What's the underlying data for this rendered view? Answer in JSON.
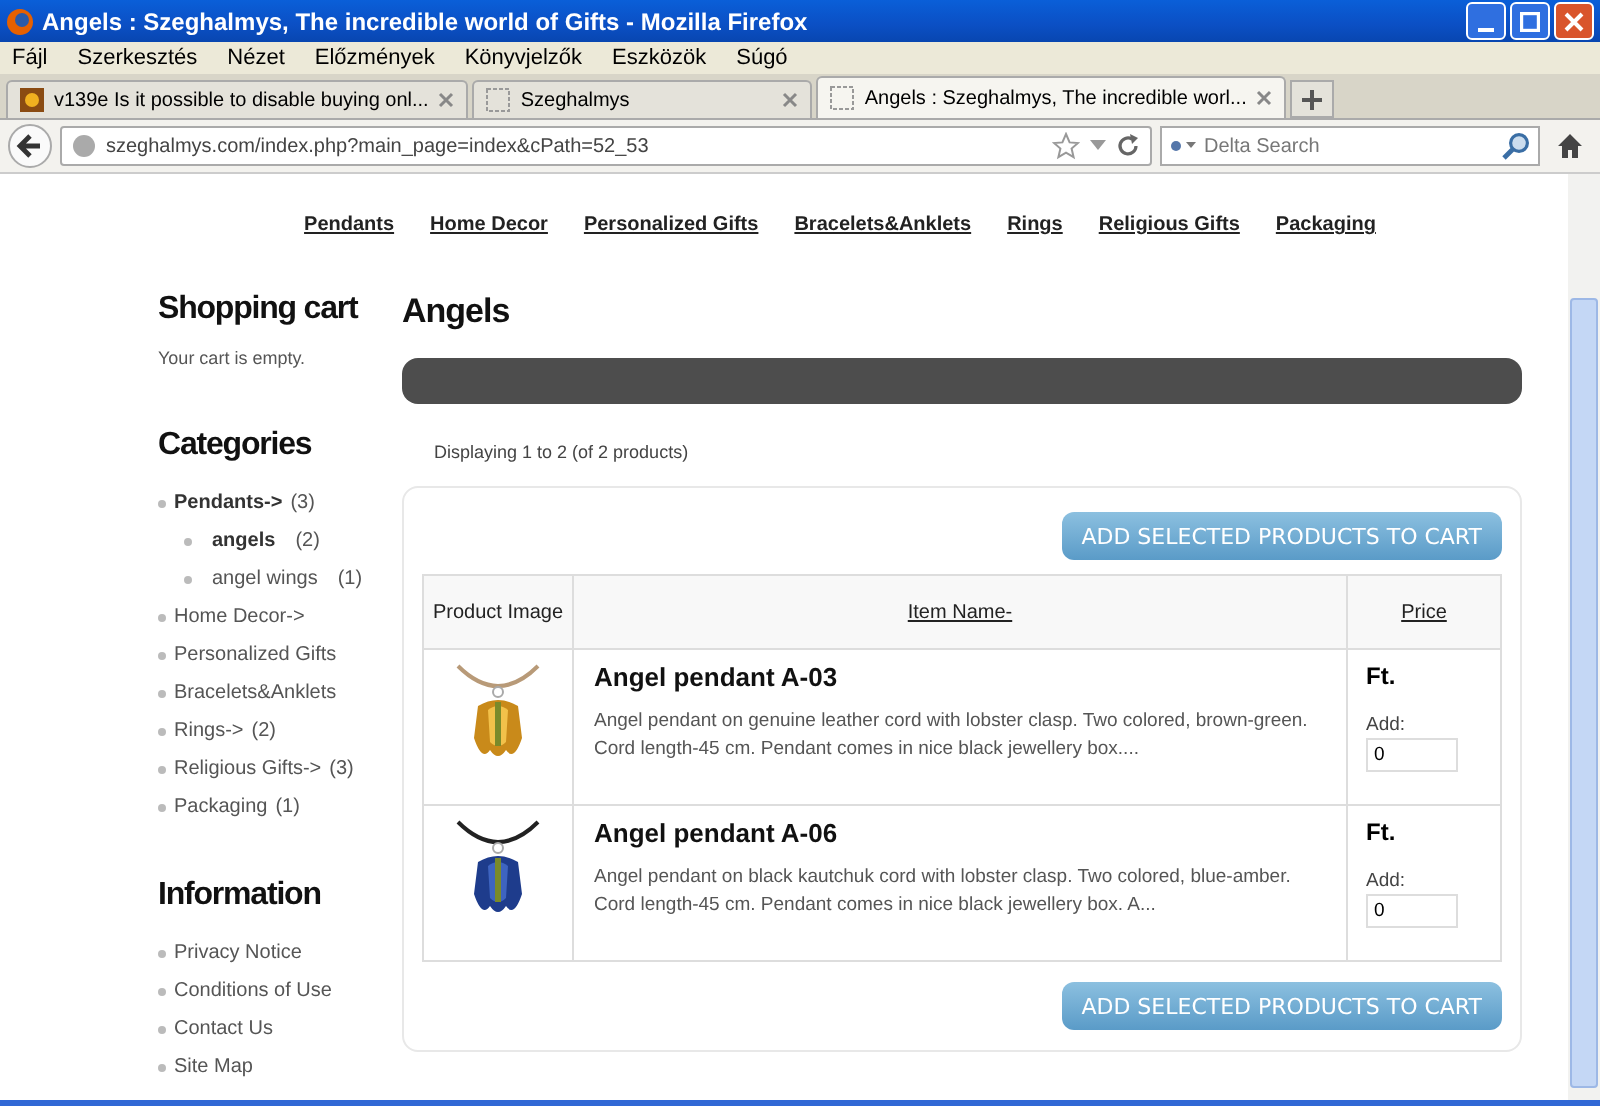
{
  "window": {
    "title": "Angels : Szeghalmys, The incredible world of Gifts - Mozilla Firefox"
  },
  "menu": [
    "Fájl",
    "Szerkesztés",
    "Nézet",
    "Előzmények",
    "Könyvjelzők",
    "Eszközök",
    "Súgó"
  ],
  "tabs": [
    {
      "label": "v139e Is it possible to disable buying onl...",
      "selected": false,
      "kind": "favicon"
    },
    {
      "label": "Szeghalmys",
      "selected": false,
      "kind": "blank"
    },
    {
      "label": "Angels : Szeghalmys, The incredible worl...",
      "selected": true,
      "kind": "blank"
    }
  ],
  "address_bar": {
    "url": "szeghalmys.com/index.php?main_page=index&cPath=52_53"
  },
  "search": {
    "placeholder": "Delta Search"
  },
  "site_nav": [
    "Pendants",
    "Home Decor",
    "Personalized Gifts",
    "Bracelets&Anklets",
    "Rings",
    "Religious Gifts",
    "Packaging"
  ],
  "sidebar": {
    "cart_title": "Shopping cart",
    "cart_text": "Your cart is empty.",
    "categories_title": "Categories",
    "categories": [
      {
        "label": "Pendants->",
        "count": "(3)",
        "selected": true,
        "children": [
          {
            "label": "angels",
            "count": "(2)",
            "selected": true
          },
          {
            "label": "angel wings",
            "count": "(1)",
            "selected": false
          }
        ]
      },
      {
        "label": "Home Decor->",
        "selected": false
      },
      {
        "label": "Personalized Gifts",
        "selected": false
      },
      {
        "label": "Bracelets&Anklets",
        "selected": false
      },
      {
        "label": "Rings->",
        "count": "(2)",
        "selected": false
      },
      {
        "label": "Religious Gifts->",
        "count": "(3)",
        "selected": false
      },
      {
        "label": "Packaging",
        "count": "(1)",
        "selected": false
      }
    ],
    "information_title": "Information",
    "information": [
      "Privacy Notice",
      "Conditions of Use",
      "Contact Us",
      "Site Map"
    ]
  },
  "main": {
    "title": "Angels",
    "listing_count": "Displaying 1 to 2 (of 2 products)",
    "add_button": "ADD SELECTED PRODUCTS TO CART",
    "table": {
      "columns": [
        "Product Image",
        "Item Name-",
        "Price"
      ],
      "rows": [
        {
          "name": "Angel pendant A-03",
          "description": "Angel pendant on genuine leather cord with lobster clasp. Two colored, brown-green. Cord length-45 cm. Pendant comes in nice black jewellery box....",
          "price": "Ft.",
          "add_label": "Add:",
          "quantity": "0",
          "kind": "amber"
        },
        {
          "name": "Angel pendant A-06",
          "description": "Angel pendant on black kautchuk cord with lobster clasp. Two colored, blue-amber. Cord length-45 cm. Pendant comes in nice black jewellery box. A...",
          "price": "Ft.",
          "add_label": "Add:",
          "quantity": "0",
          "kind": "blue"
        }
      ]
    },
    "add_button_bottom": "ADD SELECTED PRODUCTS TO CART"
  }
}
